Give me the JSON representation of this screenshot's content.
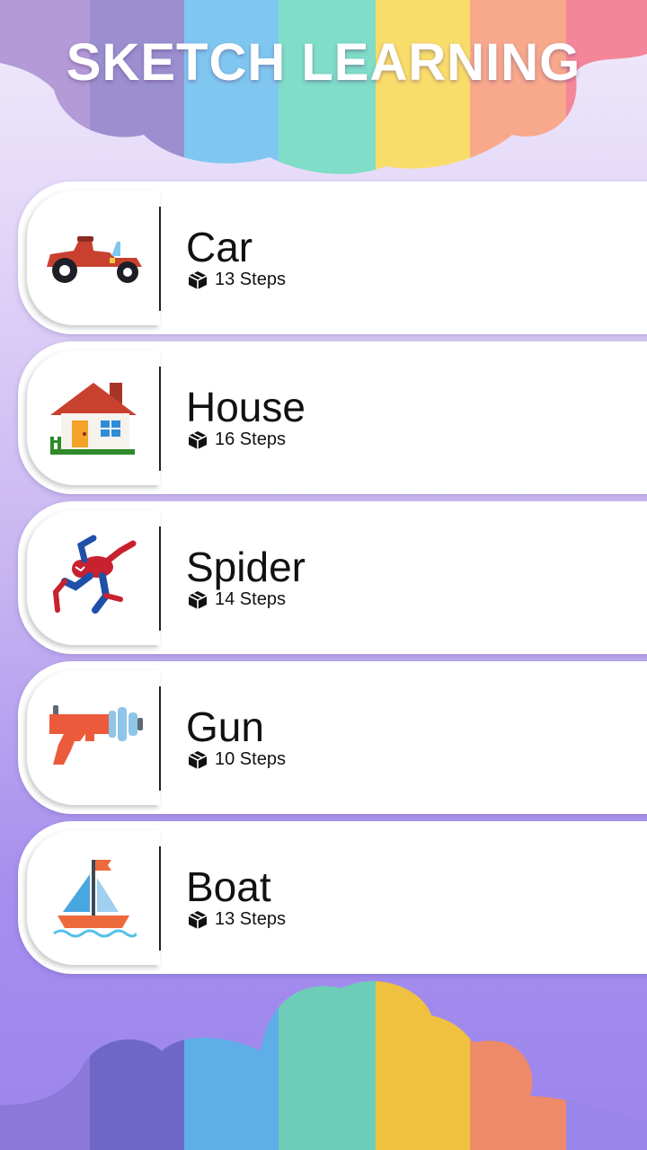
{
  "app": {
    "title": "SKETCH LEARNING"
  },
  "lessons": [
    {
      "name": "Car",
      "steps": "13 Steps",
      "icon": "car-icon"
    },
    {
      "name": "House",
      "steps": "16 Steps",
      "icon": "house-icon"
    },
    {
      "name": "Spider",
      "steps": "14 Steps",
      "icon": "spiderman-icon"
    },
    {
      "name": "Gun",
      "steps": "10 Steps",
      "icon": "water-gun-icon"
    },
    {
      "name": "Boat",
      "steps": "13 Steps",
      "icon": "sailboat-icon"
    }
  ],
  "colors": {
    "stripe_1": "#9b8fd0",
    "stripe_2": "#7fc7f0",
    "stripe_3": "#7fddc8",
    "stripe_4": "#f9dd6a",
    "stripe_5": "#f8a98c",
    "stripe_6": "#f4869a",
    "card": "#ffffff",
    "text": "#111111"
  }
}
